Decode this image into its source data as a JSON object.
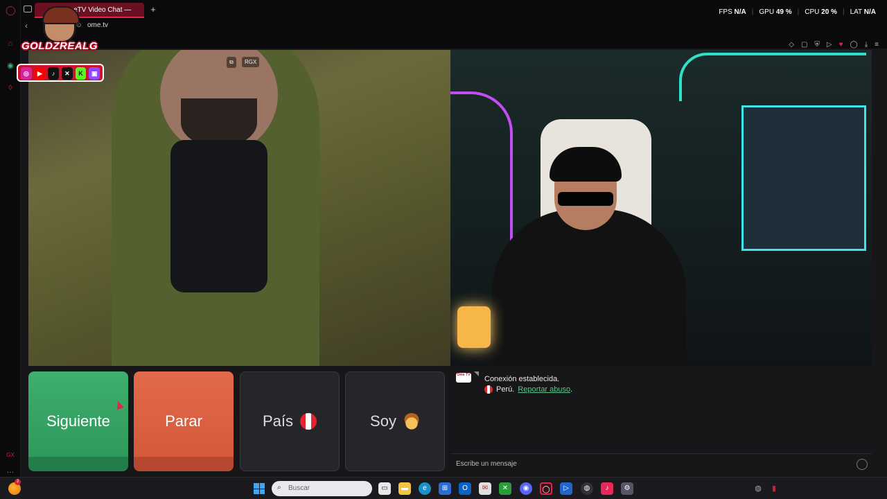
{
  "browser": {
    "tab_title": "OmeTV Video Chat —",
    "url": "ome.tv",
    "stats": {
      "fps_label": "FPS",
      "fps": "N/A",
      "gpu_label": "GPU",
      "gpu": "49 %",
      "cpu_label": "CPU",
      "cpu": "20 %",
      "lat_label": "LAT",
      "lat": "N/A"
    }
  },
  "overlay": {
    "brand_name": "GOLDZREALG"
  },
  "video": {
    "badge": "RGX"
  },
  "controls": {
    "next_label": "Siguiente",
    "stop_label": "Parar",
    "country_label": "País",
    "gender_label": "Soy"
  },
  "chat": {
    "connection_message": "Conexión establecida.",
    "country": "Perú.",
    "report_link": "Reportar abuso",
    "report_suffix": ".",
    "input_placeholder": "Escribe un mensaje",
    "logo_text": "Ome TV"
  },
  "left_rail": {
    "gx_label": "GX"
  },
  "taskbar": {
    "search_placeholder": "Buscar",
    "weather_badge": "2"
  },
  "colors": {
    "next": "#3fae6f",
    "stop": "#e16a4a",
    "accent": "#e0264a",
    "link": "#5fc28a"
  }
}
